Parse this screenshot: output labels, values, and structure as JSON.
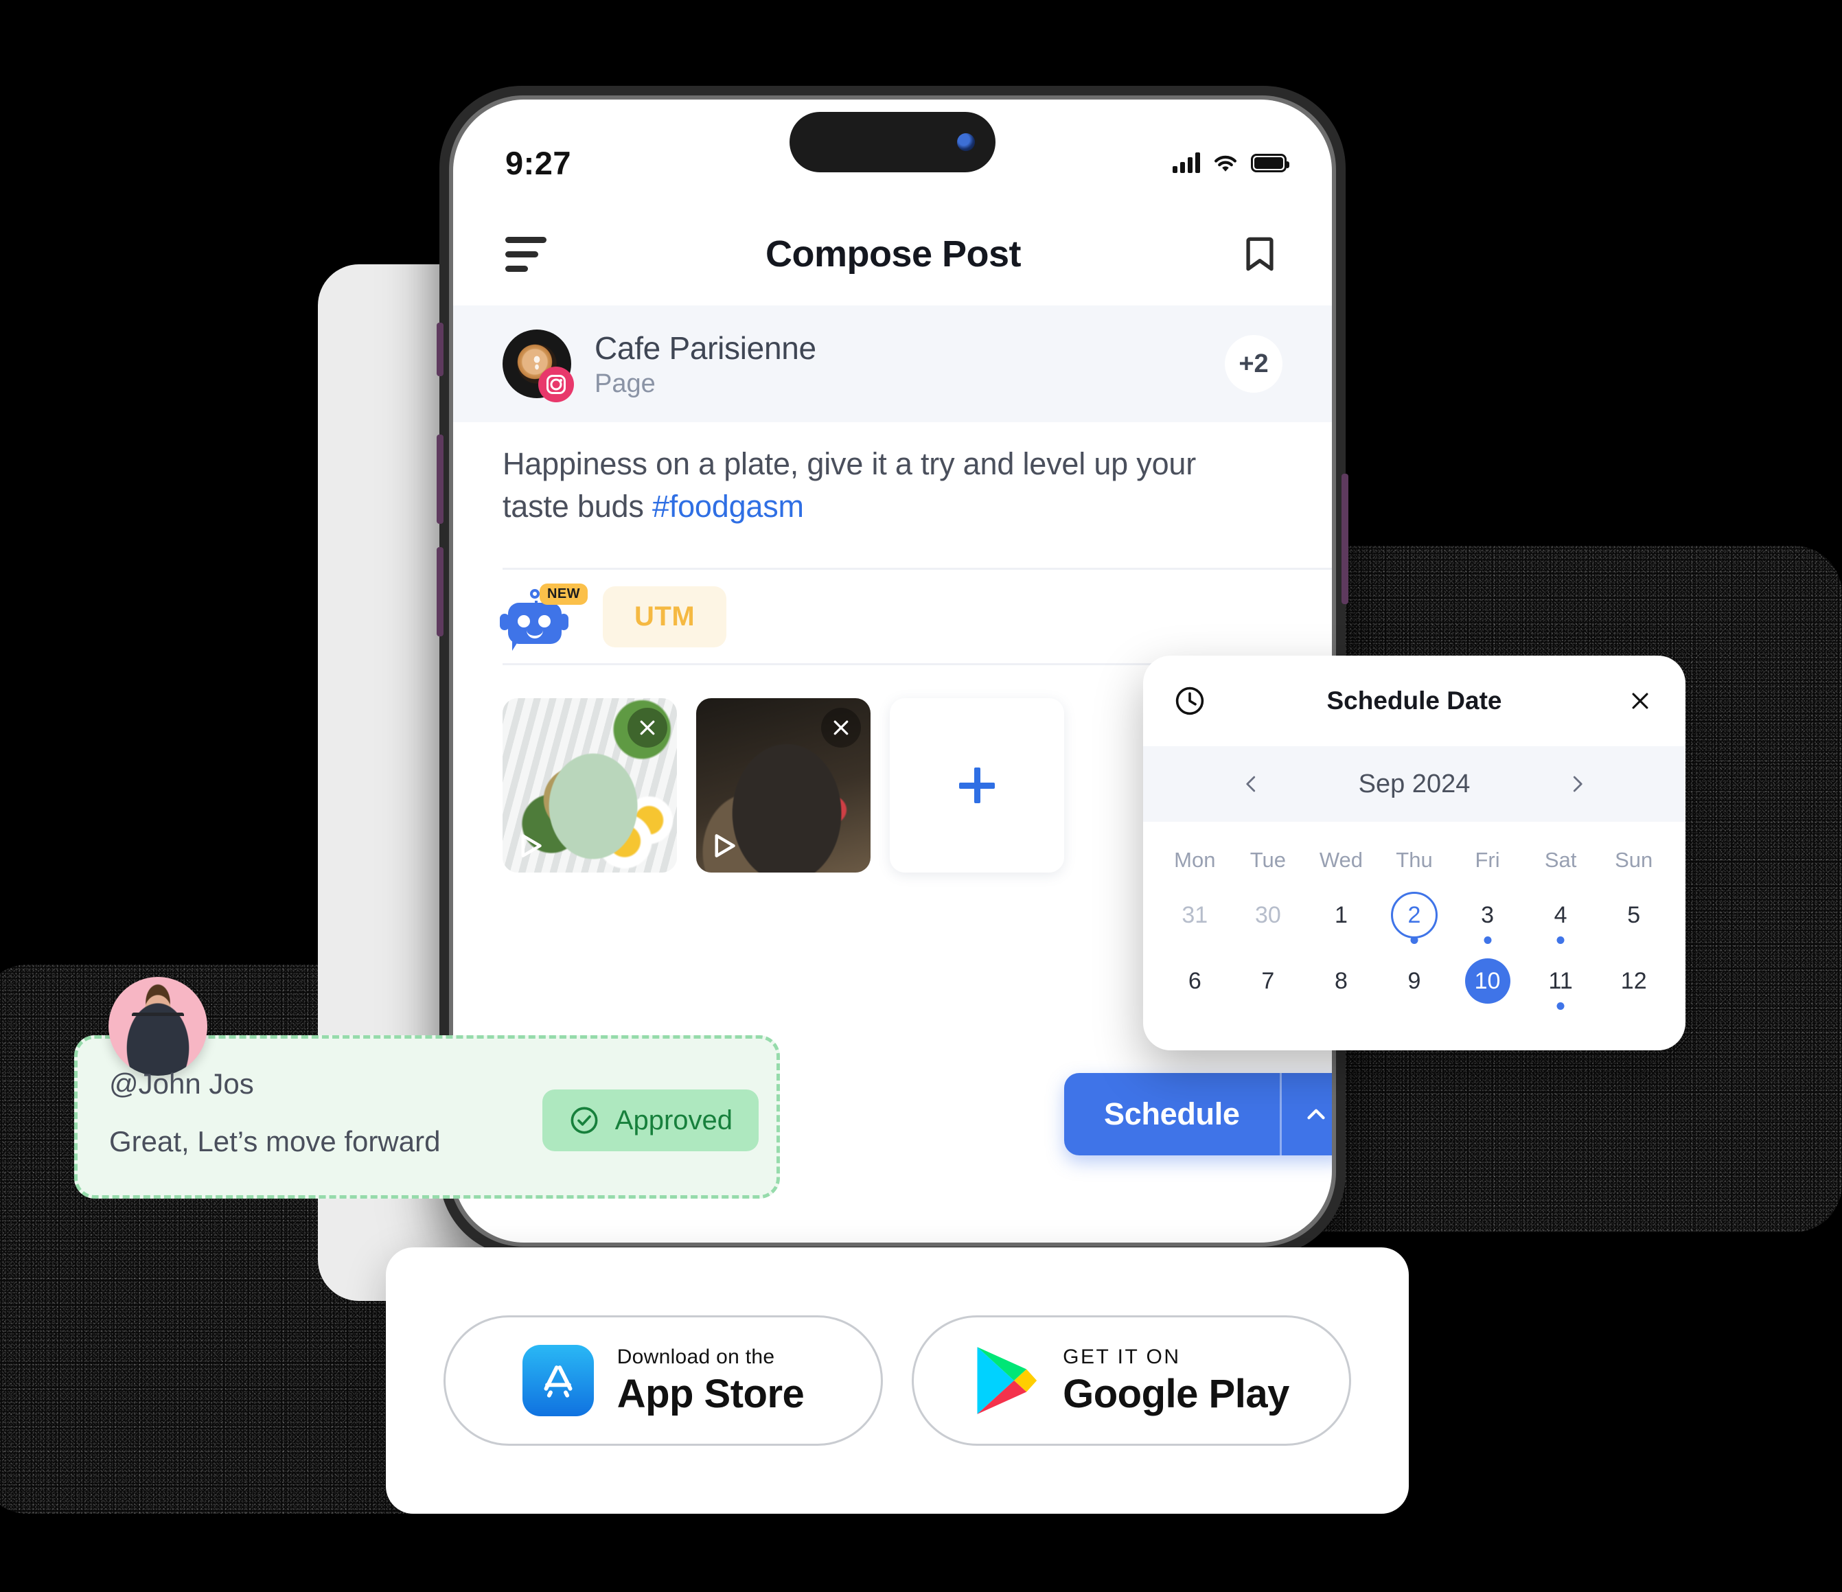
{
  "statusbar": {
    "time": "9:27",
    "signal_icon": "cellular-bars-icon",
    "wifi_icon": "wifi-icon",
    "battery_icon": "battery-icon"
  },
  "app_header": {
    "menu_icon": "hamburger-menu-icon",
    "title": "Compose Post",
    "bookmark_icon": "bookmark-icon"
  },
  "account": {
    "name": "Cafe Parisienne",
    "type": "Page",
    "network_icon": "instagram-icon",
    "more_count": "+2"
  },
  "composer": {
    "text": "Happiness on a plate, give it a try and level up your taste buds ",
    "hashtag": "#foodgasm"
  },
  "toolbar": {
    "bot_icon": "ai-robot-icon",
    "bot_badge": "NEW",
    "utm_label": "UTM"
  },
  "media": {
    "tiles": [
      {
        "alt": "rice bowl with eggs",
        "close_icon": "close-icon",
        "play_icon": "play-icon"
      },
      {
        "alt": "salad bowl",
        "close_icon": "close-icon",
        "play_icon": "play-icon"
      }
    ],
    "add_icon": "plus-icon"
  },
  "schedule_button": {
    "label": "Schedule",
    "caret_icon": "chevron-up-icon"
  },
  "calendar": {
    "clock_icon": "clock-icon",
    "title": "Schedule Date",
    "close_icon": "close-icon",
    "prev_icon": "chevron-left-icon",
    "next_icon": "chevron-right-icon",
    "month_label": "Sep 2024",
    "weekdays": [
      "Mon",
      "Tue",
      "Wed",
      "Thu",
      "Fri",
      "Sat",
      "Sun"
    ],
    "days": [
      {
        "n": "31",
        "muted": true
      },
      {
        "n": "30",
        "muted": true
      },
      {
        "n": "1"
      },
      {
        "n": "2",
        "outlined": true,
        "dot": true
      },
      {
        "n": "3",
        "dot": true
      },
      {
        "n": "4",
        "dot": true
      },
      {
        "n": "5"
      },
      {
        "n": "6"
      },
      {
        "n": "7"
      },
      {
        "n": "8"
      },
      {
        "n": "9"
      },
      {
        "n": "10",
        "selected": true
      },
      {
        "n": "11",
        "dot": true
      },
      {
        "n": "12"
      }
    ],
    "accent_color": "#3f74e8"
  },
  "approval": {
    "avatar": "user-avatar",
    "username": "@John Jos",
    "message": "Great, Let’s move forward",
    "badge_label": "Approved",
    "badge_icon": "check-circle-icon",
    "badge_color": "#17803c"
  },
  "store": {
    "apple": {
      "icon": "apple-app-store-icon",
      "small": "Download on the",
      "big": "App Store"
    },
    "google": {
      "icon": "google-play-icon",
      "small": "GET IT ON",
      "big": "Google Play"
    }
  }
}
